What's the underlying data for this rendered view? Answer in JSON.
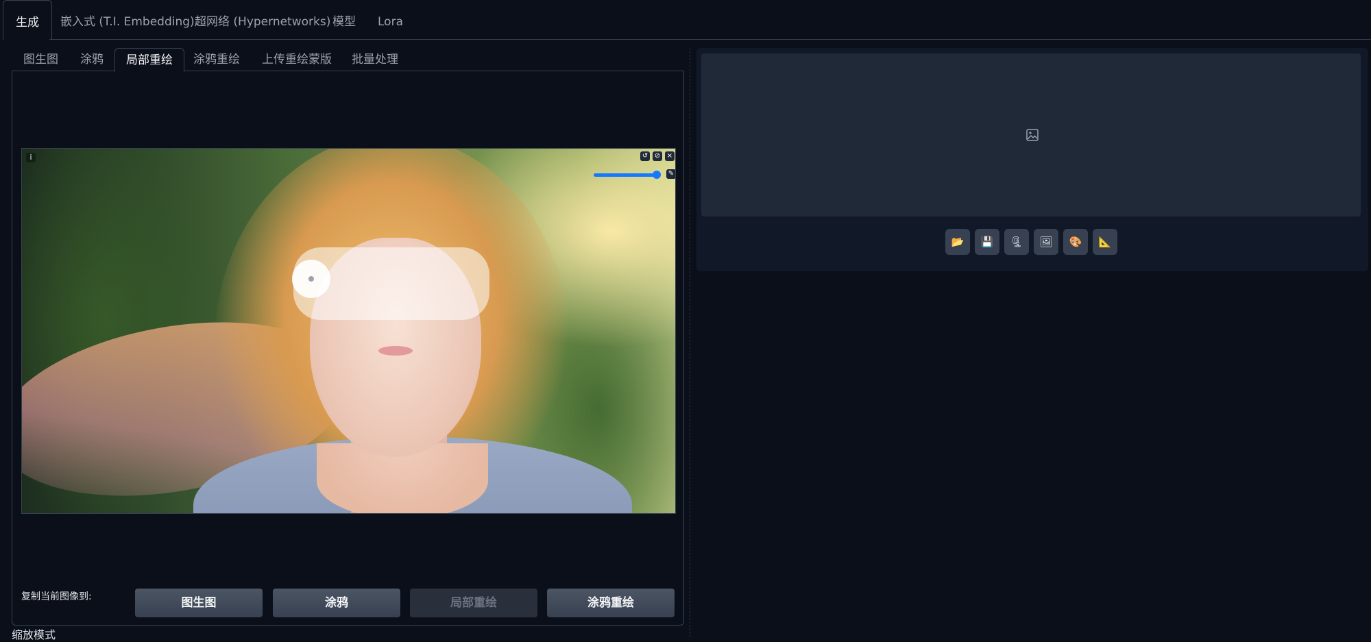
{
  "top_tabs": [
    {
      "label": "生成",
      "active": true
    },
    {
      "label": "嵌入式 (T.I. Embedding)",
      "active": false
    },
    {
      "label": "超网络 (Hypernetworks)",
      "active": false
    },
    {
      "label": "模型",
      "active": false
    },
    {
      "label": "Lora",
      "active": false
    }
  ],
  "sub_tabs": [
    {
      "label": "图生图",
      "active": false
    },
    {
      "label": "涂鸦",
      "active": false
    },
    {
      "label": "局部重绘",
      "active": true
    },
    {
      "label": "涂鸦重绘",
      "active": false
    },
    {
      "label": "上传重绘蒙版",
      "active": false
    },
    {
      "label": "批量处理",
      "active": false
    }
  ],
  "canvas": {
    "info_icon": "i",
    "undo_icon": "↺",
    "clear_icon": "⊘",
    "close_icon": "×",
    "brush_icon": "✎",
    "brush_size_percent": 95
  },
  "copy_to": {
    "label": "复制当前图像到:",
    "buttons": [
      {
        "label": "图生图",
        "enabled": true
      },
      {
        "label": "涂鸦",
        "enabled": true
      },
      {
        "label": "局部重绘",
        "enabled": false
      },
      {
        "label": "涂鸦重绘",
        "enabled": true
      }
    ]
  },
  "zoom_mode_label": "缩放模式",
  "output_tools": [
    {
      "icon": "folder-icon",
      "glyph": "📂"
    },
    {
      "icon": "save-icon",
      "glyph": "💾"
    },
    {
      "icon": "zip-icon",
      "glyph": "🗜"
    },
    {
      "icon": "send-to-img2img-icon",
      "glyph": "🖼"
    },
    {
      "icon": "send-to-inpaint-icon",
      "glyph": "🎨"
    },
    {
      "icon": "send-to-extras-icon",
      "glyph": "📐"
    }
  ],
  "colors": {
    "background": "#0b0f19",
    "accent": "#1677ff",
    "panel": "#111827"
  }
}
